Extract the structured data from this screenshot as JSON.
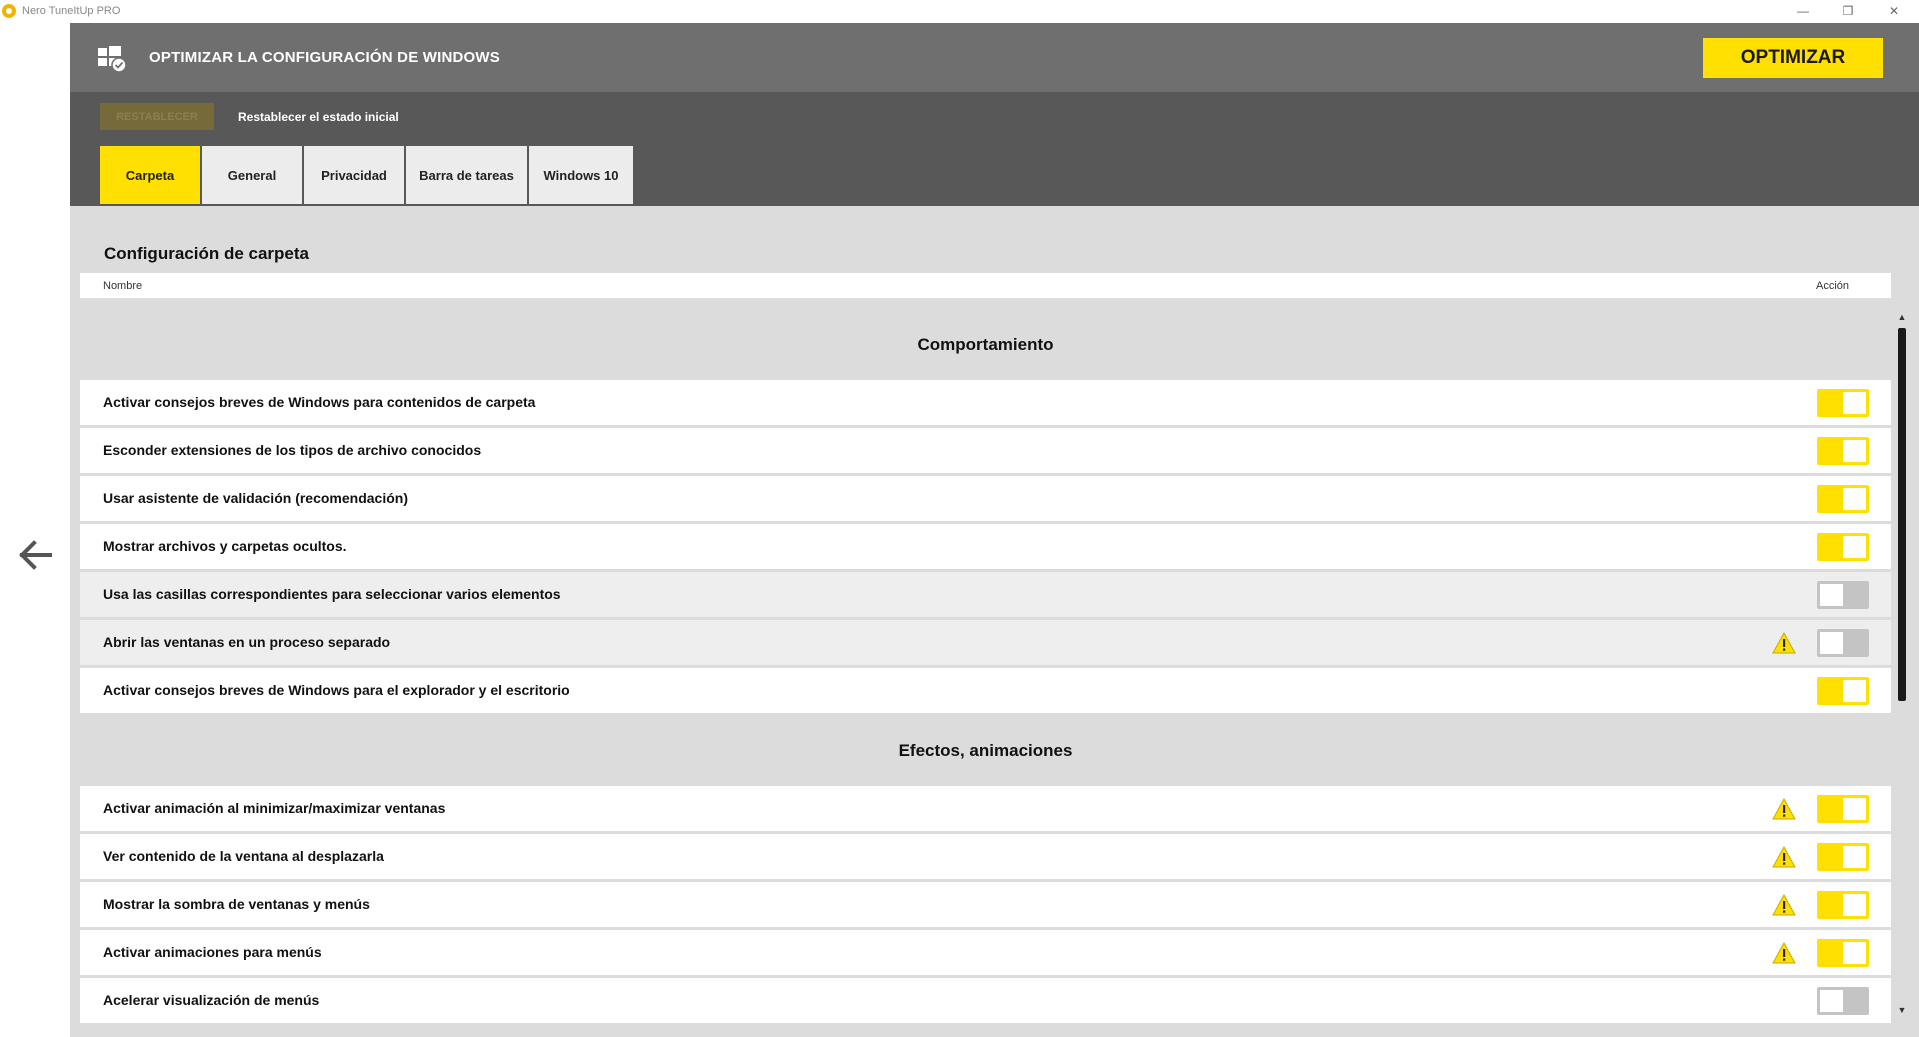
{
  "window": {
    "title": "Nero TuneItUp PRO",
    "minimize": "—",
    "maximize": "❐",
    "close": "✕"
  },
  "header": {
    "title": "OPTIMIZAR LA CONFIGURACIÓN DE WINDOWS",
    "optimize_label": "OPTIMIZAR"
  },
  "resetbar": {
    "reset_label": "RESTABLECER",
    "reset_text": "Restablecer el estado inicial"
  },
  "tabs": [
    {
      "label": "Carpeta",
      "active": true
    },
    {
      "label": "General",
      "active": false
    },
    {
      "label": "Privacidad",
      "active": false
    },
    {
      "label": "Barra de tareas",
      "active": false
    },
    {
      "label": "Windows 10",
      "active": false
    }
  ],
  "content": {
    "section_title": "Configuración de carpeta",
    "col_name": "Nombre",
    "col_action": "Acción"
  },
  "groups": [
    {
      "title": "Comportamiento",
      "rows": [
        {
          "label": "Activar consejos breves de Windows para contenidos de carpeta",
          "on": true,
          "warning": false
        },
        {
          "label": "Esconder extensiones de los tipos de archivo conocidos",
          "on": true,
          "warning": false
        },
        {
          "label": "Usar asistente de validación (recomendación)",
          "on": true,
          "warning": false
        },
        {
          "label": "Mostrar archivos y carpetas ocultos.",
          "on": true,
          "warning": false
        },
        {
          "label": "Usa las casillas correspondientes para seleccionar varios elementos",
          "on": false,
          "warning": false
        },
        {
          "label": "Abrir las ventanas en un proceso separado",
          "on": false,
          "warning": true
        },
        {
          "label": "Activar consejos breves de Windows para el explorador y el escritorio",
          "on": true,
          "warning": false
        }
      ]
    },
    {
      "title": "Efectos, animaciones",
      "rows": [
        {
          "label": "Activar animación al minimizar/maximizar ventanas",
          "on": true,
          "warning": true
        },
        {
          "label": "Ver contenido de la ventana al desplazarla",
          "on": true,
          "warning": true
        },
        {
          "label": "Mostrar la sombra de ventanas y menús",
          "on": true,
          "warning": true
        },
        {
          "label": "Activar animaciones para menús",
          "on": true,
          "warning": true
        },
        {
          "label": "Acelerar visualización de menús",
          "on": false,
          "warning": false
        }
      ]
    }
  ],
  "colors": {
    "accent": "#ffe000",
    "header_bg": "#6f6f6f",
    "bar_bg": "#585858",
    "content_bg": "#dcdcdc"
  },
  "icons": {
    "back": "arrow-left-icon",
    "header": "windows-settings-icon",
    "warning": "warning-icon"
  }
}
